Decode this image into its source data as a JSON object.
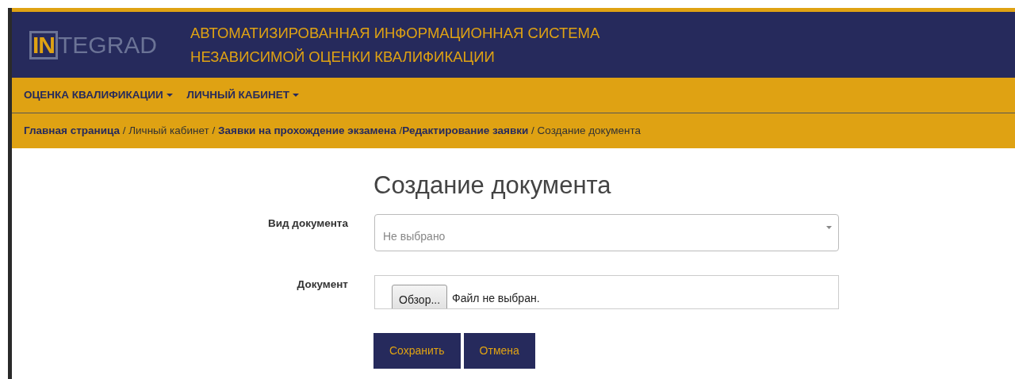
{
  "header": {
    "logo": {
      "highlight": "IN",
      "rest": "TEGRAD"
    },
    "title_lines": [
      "АВТОМАТИЗИРОВАННАЯ ИНФОРМАЦИОННАЯ СИСТЕМА",
      "НЕЗАВИСИМОЙ ОЦЕНКИ КВАЛИФИКАЦИИ"
    ]
  },
  "menu": [
    {
      "label": "ОЦЕНКА КВАЛИФИКАЦИИ"
    },
    {
      "label": "ЛИЧНЫЙ КАБИНЕТ"
    }
  ],
  "breadcrumb": [
    {
      "text": "Главная страница",
      "kind": "link"
    },
    {
      "text": " / ",
      "kind": "separator"
    },
    {
      "text": "Личный кабинет",
      "kind": "text"
    },
    {
      "text": " / ",
      "kind": "separator"
    },
    {
      "text": "Заявки на прохождение экзамена",
      "kind": "link"
    },
    {
      "text": " /",
      "kind": "separator"
    },
    {
      "text": "Редактирование заявки",
      "kind": "link"
    },
    {
      "text": " / ",
      "kind": "separator"
    },
    {
      "text": "Создание документа",
      "kind": "text"
    }
  ],
  "page_title": "Создание документа",
  "fields": [
    {
      "label": "Вид документа",
      "kind": "select",
      "placeholder": "Не выбрано"
    },
    {
      "label": "Документ",
      "kind": "file",
      "button": "Обзор...",
      "status": "Файл не выбран."
    }
  ],
  "buttons": [
    "Сохранить",
    "Отмена"
  ]
}
